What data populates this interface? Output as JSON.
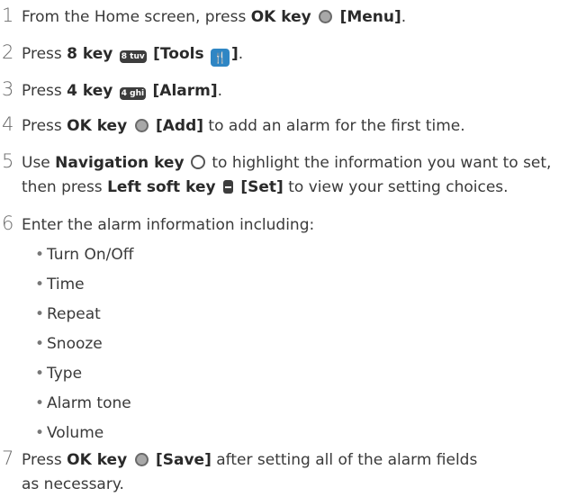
{
  "steps": [
    {
      "num": "1",
      "pre": "From the Home screen, press ",
      "key": "OK key",
      "icon": "ok-key-icon",
      "bracket": "[Menu]",
      "post": "."
    },
    {
      "num": "2",
      "pre": "Press ",
      "key": "8 key",
      "icon_text": "8 tuv",
      "bracket_start": "[Tools",
      "bracket_end": "]",
      "post": "."
    },
    {
      "num": "3",
      "pre": "Press ",
      "key": "4 key",
      "icon_text": "4 ghi",
      "bracket": "[Alarm]",
      "post": "."
    },
    {
      "num": "4",
      "pre": "Press ",
      "key": "OK key",
      "bracket": "[Add]",
      "post": " to add an alarm for the first time."
    },
    {
      "num": "5",
      "pre": "Use ",
      "key": "Navigation key",
      "mid": " to highlight the information you want to set, then press ",
      "key2": "Left soft key",
      "bracket": "[Set]",
      "post": " to view your setting choices."
    },
    {
      "num": "6",
      "text": "Enter the alarm information including:",
      "bullets": [
        "Turn On/Off",
        "Time",
        "Repeat",
        "Snooze",
        "Type",
        "Alarm tone",
        "Volume"
      ]
    },
    {
      "num": "7",
      "pre": "Press ",
      "key": "OK key",
      "bracket": "[Save]",
      "post": " after setting all of the alarm fields as necessary."
    }
  ],
  "bullet_char": "•",
  "icons": {
    "ok": "ok-key-icon",
    "nav": "navigation-key-icon",
    "soft": "left-soft-key-icon",
    "tools": "tools-icon"
  },
  "colors": {
    "text": "#3a3a3a",
    "tools_bg": "#2f86c4"
  }
}
